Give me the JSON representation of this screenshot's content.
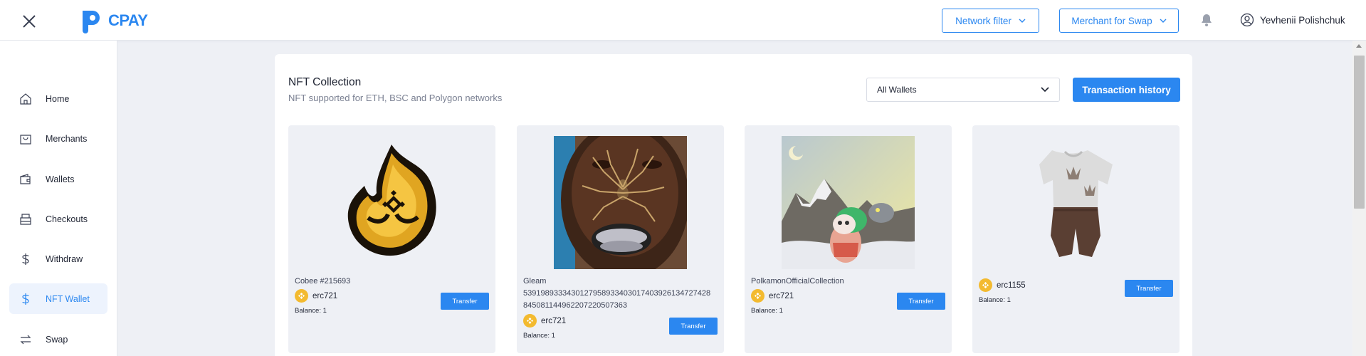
{
  "header": {
    "logo_text": "CPAY",
    "network_filter_label": "Network filter",
    "merchant_swap_label": "Merchant for Swap",
    "user_name": "Yevhenii Polishchuk",
    "colors": {
      "accent": "#2b87f0"
    }
  },
  "sidebar": {
    "items": [
      {
        "label": "Home",
        "icon": "home-icon"
      },
      {
        "label": "Merchants",
        "icon": "bag-icon"
      },
      {
        "label": "Wallets",
        "icon": "wallet-icon"
      },
      {
        "label": "Checkouts",
        "icon": "checkout-icon"
      },
      {
        "label": "Withdraw",
        "icon": "dollar-icon"
      },
      {
        "label": "NFT Wallet",
        "icon": "dollar-icon",
        "active": true
      },
      {
        "label": "Swap",
        "icon": "swap-icon"
      }
    ]
  },
  "main": {
    "title": "NFT Collection",
    "subtitle": "NFT supported for ETH, BSC and Polygon networks",
    "wallet_filter_value": "All Wallets",
    "transaction_history_label": "Transaction history",
    "nfts": [
      {
        "name": "Cobee #215693",
        "standard": "erc721",
        "balance": "Balance: 1",
        "transfer_label": "Transfer",
        "image": "fire-emblem"
      },
      {
        "name_line1": "Gleam",
        "name_line2": "5391989333430127958933403017403926134727428",
        "name_line3": "845081144962207220507363",
        "standard": "erc721",
        "balance": "Balance: 1",
        "transfer_label": "Transfer",
        "image": "spider-face"
      },
      {
        "name": "PolkamonOfficialCollection",
        "standard": "erc721",
        "balance": "Balance: 1",
        "transfer_label": "Transfer",
        "image": "mountain-creature"
      },
      {
        "standard": "erc1155",
        "balance": "Balance: 1",
        "transfer_label": "Transfer",
        "image": "shirt-shorts"
      }
    ]
  }
}
